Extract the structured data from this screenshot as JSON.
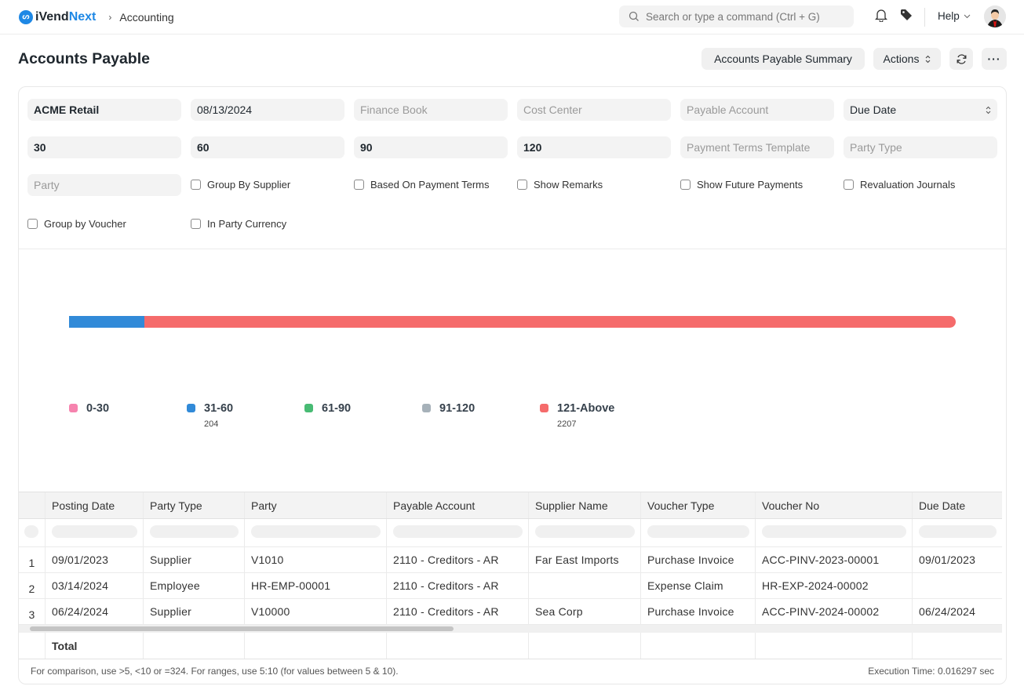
{
  "navbar": {
    "brand_i": "iVend",
    "brand_n": "Next",
    "breadcrumb": "Accounting",
    "search_placeholder": "Search or type a command (Ctrl + G)",
    "help_label": "Help"
  },
  "page": {
    "title": "Accounts Payable",
    "buttons": {
      "summary": "Accounts Payable Summary",
      "actions": "Actions"
    }
  },
  "filters": {
    "company": "ACME Retail",
    "report_date": "08/13/2024",
    "finance_book_placeholder": "Finance Book",
    "cost_center_placeholder": "Cost Center",
    "payable_account_placeholder": "Payable Account",
    "ageing_based_on": "Due Date",
    "range1": "30",
    "range2": "60",
    "range3": "90",
    "range4": "120",
    "payment_terms_template_placeholder": "Payment Terms Template",
    "party_type_placeholder": "Party Type",
    "party_placeholder": "Party",
    "checkboxes": [
      {
        "label": "Group By Supplier",
        "checked": false
      },
      {
        "label": "Based On Payment Terms",
        "checked": false
      },
      {
        "label": "Show Remarks",
        "checked": false
      },
      {
        "label": "Show Future Payments",
        "checked": false
      },
      {
        "label": "Revaluation Journals",
        "checked": false
      },
      {
        "label": "Group by Voucher",
        "checked": false
      },
      {
        "label": "In Party Currency",
        "checked": false
      }
    ]
  },
  "chart_data": {
    "type": "bar",
    "orientation": "horizontal-stacked-percentage",
    "categories": [
      "0-30",
      "31-60",
      "61-90",
      "91-120",
      "121-Above"
    ],
    "values": [
      0,
      204,
      0,
      0,
      2207
    ],
    "colors": [
      "#f683ae",
      "#318ad8",
      "#48bb74",
      "#a6b1b9",
      "#f56b6b"
    ],
    "legend": "bottom-left",
    "title": "",
    "xlabel": "",
    "ylabel": ""
  },
  "table": {
    "columns": [
      "Posting Date",
      "Party Type",
      "Party",
      "Payable Account",
      "Supplier Name",
      "Voucher Type",
      "Voucher No",
      "Due Date"
    ],
    "rows": [
      {
        "n": "1",
        "cells": [
          "09/01/2023",
          "Supplier",
          "V1010",
          "2110 - Creditors - AR",
          "Far East Imports",
          "Purchase Invoice",
          "ACC-PINV-2023-00001",
          "09/01/2023"
        ]
      },
      {
        "n": "2",
        "cells": [
          "03/14/2024",
          "Employee",
          "HR-EMP-00001",
          "2110 - Creditors - AR",
          "",
          "Expense Claim",
          "HR-EXP-2024-00002",
          ""
        ]
      },
      {
        "n": "3",
        "cells": [
          "06/24/2024",
          "Supplier",
          "V10000",
          "2110 - Creditors - AR",
          "Sea Corp",
          "Purchase Invoice",
          "ACC-PINV-2024-00002",
          "06/24/2024"
        ]
      }
    ],
    "total_label": "Total"
  },
  "footer": {
    "hint": "For comparison, use >5, <10 or =324. For ranges, use 5:10 (for values between 5 & 10).",
    "execution_time": "Execution Time: 0.016297 sec"
  }
}
